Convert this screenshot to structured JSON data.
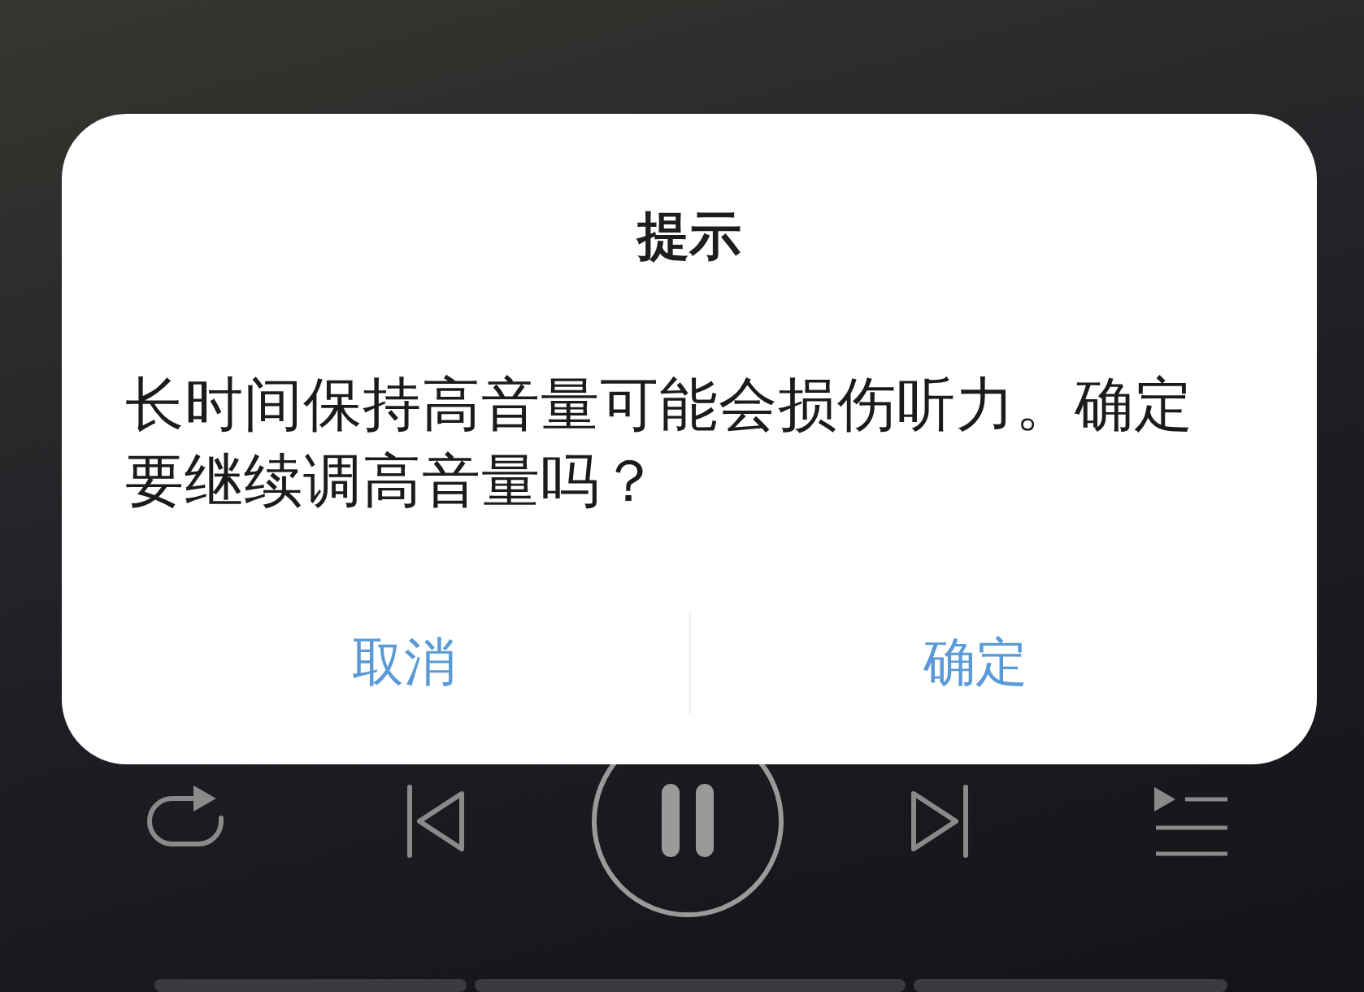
{
  "player": {
    "controls": [
      {
        "kind": "repeat"
      },
      {
        "kind": "previous"
      },
      {
        "kind": "pause"
      },
      {
        "kind": "next"
      },
      {
        "kind": "playlist"
      }
    ]
  },
  "dialog": {
    "title": "提示",
    "message": "长时间保持高音量可能会损伤听力。确定要继续调高音量吗？",
    "buttons": [
      "取消",
      "确定"
    ]
  }
}
